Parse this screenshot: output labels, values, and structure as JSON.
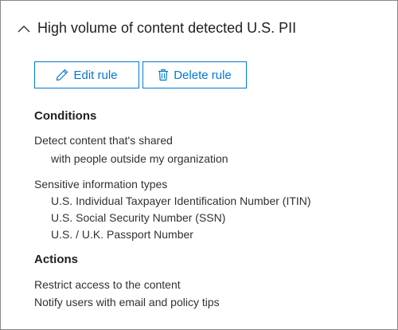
{
  "header": {
    "title": "High volume of content detected U.S. PII",
    "chevron_icon": "chevron-up-icon"
  },
  "buttons": {
    "edit": {
      "label": "Edit rule",
      "icon": "pencil-icon"
    },
    "delete": {
      "label": "Delete rule",
      "icon": "trash-icon"
    }
  },
  "conditions": {
    "heading": "Conditions",
    "detect_label": "Detect content that's shared",
    "detect_value": "with people outside my organization",
    "sit_label": "Sensitive information types",
    "sit_items": [
      "U.S. Individual Taxpayer Identification Number (ITIN)",
      "U.S. Social Security Number (SSN)",
      "U.S. / U.K. Passport Number"
    ]
  },
  "actions": {
    "heading": "Actions",
    "items": [
      "Restrict access to the content",
      "Notify users with email and policy tips"
    ]
  },
  "colors": {
    "accent": "#0078d4",
    "text": "#323130",
    "border": "#8a8886"
  }
}
